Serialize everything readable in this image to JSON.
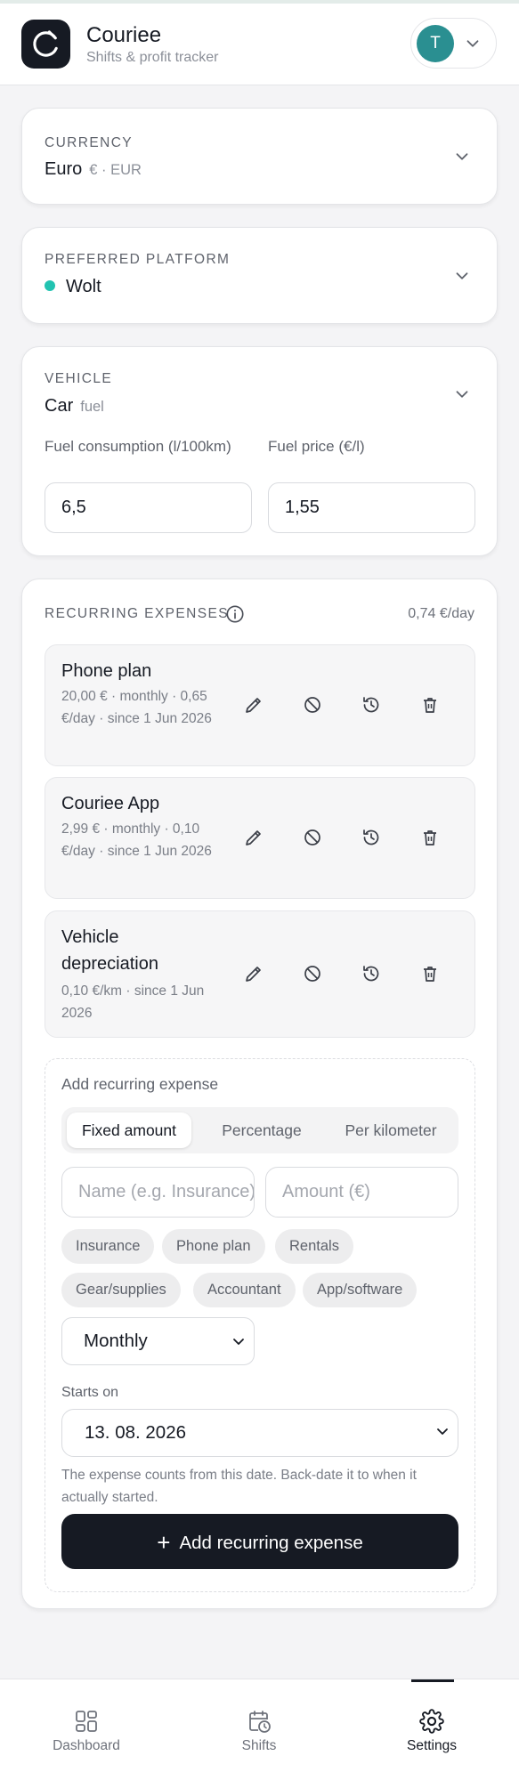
{
  "header": {
    "app_name": "Couriee",
    "subtitle": "Shifts & profit tracker",
    "user_initial": "T"
  },
  "currency": {
    "label": "CURRENCY",
    "value": "Euro",
    "detail": "€ · EUR"
  },
  "platform": {
    "label": "PREFERRED PLATFORM",
    "value": "Wolt",
    "dot_color": "#22c3b1"
  },
  "vehicle": {
    "label": "VEHICLE",
    "value": "Car",
    "detail": "fuel",
    "fuel_consumption_label": "Fuel consumption (l/100km)",
    "fuel_consumption_value": "6,5",
    "fuel_price_label": "Fuel price (€/l)",
    "fuel_price_value": "1,55"
  },
  "recurring": {
    "label": "RECURRING EXPENSES",
    "daily_total": "0,74 €/day",
    "items": [
      {
        "name": "Phone plan",
        "meta": "20,00 € · monthly · 0,65 €/day · since 1 Jun 2026"
      },
      {
        "name": "Couriee App",
        "meta": "2,99 € · monthly · 0,10 €/day · since 1 Jun 2026"
      },
      {
        "name": "Vehicle depreciation",
        "meta": "0,10 €/km · since 1 Jun 2026"
      }
    ],
    "add": {
      "title": "Add recurring expense",
      "modes": [
        "Fixed amount",
        "Percentage",
        "Per kilometer"
      ],
      "active_mode": "Fixed amount",
      "name_placeholder": "Name (e.g. Insurance)",
      "amount_placeholder": "Amount (€)",
      "suggestions": [
        "Insurance",
        "Phone plan",
        "Rentals",
        "Gear/supplies",
        "Accountant",
        "App/software"
      ],
      "frequency": "Monthly",
      "starts_on_label": "Starts on",
      "start_date": "13. 08. 2026",
      "hint": "The expense counts from this date. Back-date it to when it actually started.",
      "submit_label": "Add recurring expense"
    }
  },
  "nav": {
    "items": [
      {
        "label": "Dashboard",
        "icon": "dashboard-icon"
      },
      {
        "label": "Shifts",
        "icon": "calendar-clock-icon"
      },
      {
        "label": "Settings",
        "icon": "gear-icon"
      }
    ],
    "active": "Settings"
  }
}
